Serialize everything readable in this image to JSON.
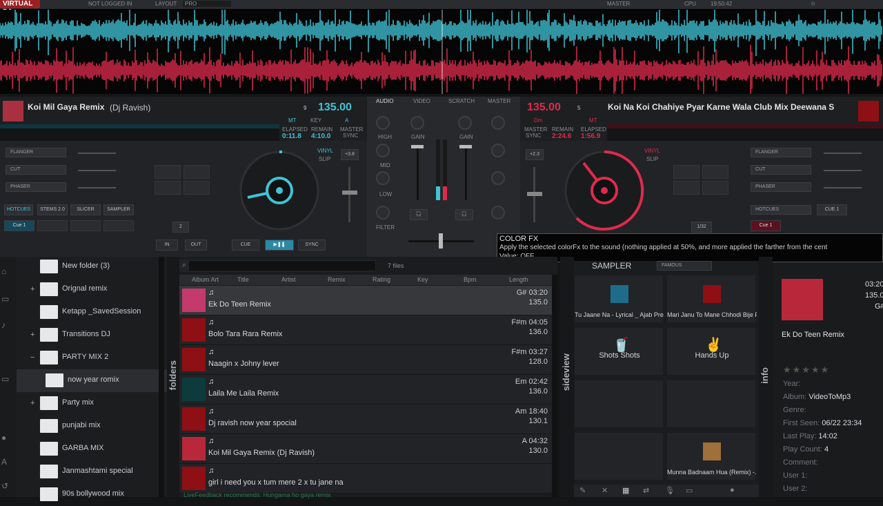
{
  "topbar": {
    "logo": "VIRTUAL DJ",
    "login": "NOT LOGGED IN",
    "layout_label": "LAYOUT",
    "layout_value": "PRO",
    "master": "MASTER",
    "cpu": "CPU",
    "time": "19:50:42"
  },
  "deck_left": {
    "title": "Koi Mil Gaya Remix",
    "artist": "(Dj Ravish)",
    "bpm": "135.00",
    "key_label": "KEY",
    "key": "A",
    "mt": "MT",
    "elapsed_label": "ELAPSED",
    "elapsed": "0:11.8",
    "remain_label": "REMAIN",
    "remain": "4:10.0",
    "master_label": "MASTER",
    "sync_label": "SYNC",
    "pitch": "+3.8",
    "beat_count": "9",
    "effects": [
      "FLANGER",
      "CUT",
      "PHASER"
    ],
    "tabs": [
      "HOTCUES",
      "STEMS 2.0",
      "SLICER",
      "SAMPLER"
    ],
    "cue1": "Cue 1",
    "loop": "2",
    "buttons": {
      "in": "IN",
      "out": "OUT",
      "cue": "CUE",
      "play": "▶❚❚",
      "sync": "SYNC"
    },
    "vinyl": "VINYL",
    "slip": "SLIP"
  },
  "deck_right": {
    "title": "Koi Na Koi Chahiye Pyar Karne Wala  Club Mix  Deewana  S",
    "bpm": "135.00",
    "key": "Dm",
    "mt": "MT",
    "master_label": "MASTER",
    "sync_label": "SYNC",
    "remain_label": "REMAIN",
    "elapsed_label": "ELAPSED",
    "remain": "2:24.6",
    "elapsed": "1:56.9",
    "pitch": "+2.3",
    "beat_count": "5",
    "effects": [
      "FLANGER",
      "CUT",
      "PHASER"
    ],
    "tabs": [
      "HOTCUES",
      "CUE 1"
    ],
    "cue1": "Cue 1",
    "loop": "1/32",
    "vinyl": "VINYL",
    "slip": "SLIP"
  },
  "mixer": {
    "tabs": [
      "AUDIO",
      "VIDEO",
      "SCRATCH",
      "MASTER"
    ],
    "labels": [
      "HIGH",
      "MID",
      "LOW",
      "FILTER",
      "GAIN"
    ]
  },
  "tooltip": {
    "title": "COLOR FX",
    "text": "Apply the selected colorFx to the sound (nothing applied at 50%, and more applied the farther from the cent",
    "value": "Value: OFF"
  },
  "folders": {
    "tab": "folders",
    "items": [
      {
        "label": "New folder (3)",
        "expand": ""
      },
      {
        "label": "Orignal remix",
        "expand": "+"
      },
      {
        "label": "Ketapp _SavedSession",
        "expand": ""
      },
      {
        "label": "Transitions DJ",
        "expand": "+"
      },
      {
        "label": "PARTY MIX 2",
        "expand": "−"
      },
      {
        "label": "now year romix",
        "expand": ""
      },
      {
        "label": "Party mix",
        "expand": "+"
      },
      {
        "label": "punjabi mix",
        "expand": ""
      },
      {
        "label": "GARBA MIX",
        "expand": ""
      },
      {
        "label": "Janmashtami special",
        "expand": ""
      },
      {
        "label": "90s bollywood mix",
        "expand": ""
      }
    ]
  },
  "browser": {
    "files": "7 files",
    "columns": [
      "Album Art",
      "Title",
      "Artist",
      "Remix",
      "Rating",
      "Key",
      "Bpm",
      "Length"
    ],
    "rows": [
      {
        "title": "Ek Do Teen Remix",
        "key": "G#",
        "length": "03:20",
        "bpm": "135.0"
      },
      {
        "title": "Bolo Tara Rara Remix",
        "key": "F#m",
        "length": "04:05",
        "bpm": "136.0"
      },
      {
        "title": "Naagin x Johny lever",
        "key": "F#m",
        "length": "03:27",
        "bpm": "128.0"
      },
      {
        "title": "Laila Me Laila Remix",
        "key": "Em",
        "length": "02:42",
        "bpm": "136.0"
      },
      {
        "title": "Dj ravish now year spocial",
        "key": "Am",
        "length": "18:40",
        "bpm": "130.1"
      },
      {
        "title": "Koi Mil Gaya Remix (Dj Ravish)",
        "key": "A",
        "length": "04:32",
        "bpm": "130.0"
      },
      {
        "title": "girl i need you x tum mere 2 x tu jane na",
        "key": "",
        "length": "",
        "bpm": ""
      }
    ],
    "recommend": "LiveFeedback recommends: Hungama ho gaya remix"
  },
  "sampler": {
    "tab": "sideview",
    "header": "SAMPLER",
    "bank": "FAMOUS",
    "cells": [
      "Tu Jaane Na - Lyrical _ Ajab Pre...",
      "Mari Janu To Mane Chhodi Bije P...",
      "Shots Shots",
      "Hands Up",
      "",
      "",
      "",
      "Munna Badnaam Hua (Remix) -..."
    ]
  },
  "info": {
    "tab": "info",
    "title": "Ek Do Teen Remix",
    "length": "03:20",
    "bpm": "135.0",
    "key": "G#",
    "fields": [
      {
        "k": "Year:",
        "v": ""
      },
      {
        "k": "Album:",
        "v": "VideoToMp3"
      },
      {
        "k": "Genre:",
        "v": ""
      },
      {
        "k": "First Seen:",
        "v": "06/22 23:34"
      },
      {
        "k": "Last Play:",
        "v": "14:02"
      },
      {
        "k": "Play Count:",
        "v": "4"
      },
      {
        "k": "Comment:",
        "v": ""
      },
      {
        "k": "User 1:",
        "v": ""
      },
      {
        "k": "User 2:",
        "v": ""
      }
    ]
  },
  "colors": {
    "deck_left": "#3fc4d6",
    "deck_right": "#e02a4c"
  }
}
